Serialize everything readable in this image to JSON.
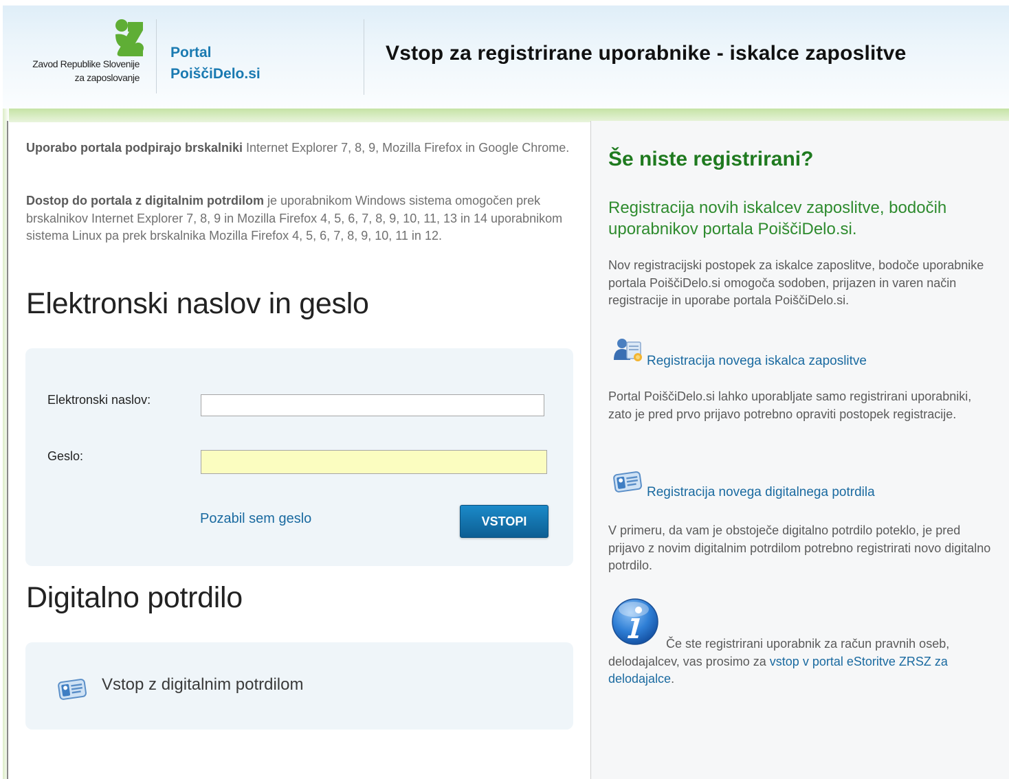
{
  "header": {
    "org_line1": "Zavod Republike Slovenije",
    "org_line2": "za zaposlovanje",
    "portal_line1": "Portal",
    "portal_line2": "PoiščiDelo.si",
    "page_title": "Vstop za registrirane uporabnike - iskalce zaposlitve"
  },
  "info": {
    "p1_bold": "Uporabo portala podpirajo brskalniki",
    "p1_text": " Internet Explorer 7, 8, 9, Mozilla Firefox in Google Chrome.",
    "p2_bold": "Dostop do portala z digitalnim potrdilom",
    "p2_text": " je uporabnikom Windows sistema omogočen prek brskalnikov Internet Explorer 7, 8, 9 in Mozilla Firefox 4, 5, 6, 7, 8, 9, 10, 11, 13 in 14 uporabnikom sistema Linux pa prek brskalnika Mozilla Firefox 4, 5, 6, 7, 8, 9, 10, 11 in 12."
  },
  "login": {
    "heading": "Elektronski naslov in geslo",
    "email_label": "Elektronski naslov:",
    "email_value": "",
    "password_label": "Geslo:",
    "password_value": "",
    "forgot_link": "Pozabil sem geslo",
    "submit_label": "VSTOPI"
  },
  "certificate": {
    "heading": "Digitalno potrdilo",
    "login_link": "Vstop z digitalnim potrdilom"
  },
  "registration": {
    "title": "Še niste registrirani?",
    "subtitle": "Registracija novih iskalcev zaposlitve, bodočih uporabnikov portala PoiščiDelo.si.",
    "intro": "Nov registracijski postopek za iskalce zaposlitve, bodoče uporabnike portala PoiščiDelo.si omogoča sodoben, prijazen in varen način registracije in uporabe portala PoiščiDelo.si.",
    "new_user_link": "Registracija novega iskalca zaposlitve",
    "new_user_text": "Portal PoiščiDelo.si lahko uporabljate samo registrirani uporabniki, zato je pred prvo prijavo potrebno opraviti postopek registracije.",
    "new_cert_link": "Registracija novega digitalnega potrdila",
    "new_cert_text": "V primeru, da vam je obstoječe digitalno potrdilo poteklo, je pred prijavo z novim digitalnim potrdilom potrebno registrirati novo digitalno potrdilo.",
    "legal_text_before": "Če ste registrirani uporabnik za račun pravnih oseb, delodajalcev, vas prosimo za ",
    "legal_link": "vstop v portal eStoritve ZRSZ za delodajalce",
    "legal_text_after": "."
  },
  "icons": {
    "logo": "zrsz-logo-icon",
    "user_registration": "user-registration-icon",
    "certificate": "id-card-icon",
    "info": "info-icon"
  },
  "colors": {
    "brand_blue": "#1a7ab1",
    "brand_green": "#7bc143",
    "heading_green": "#1f7a1f",
    "link_blue": "#1a6aa0",
    "button_blue": "#0d6fa8",
    "password_field_bg": "#fbfdc0"
  }
}
